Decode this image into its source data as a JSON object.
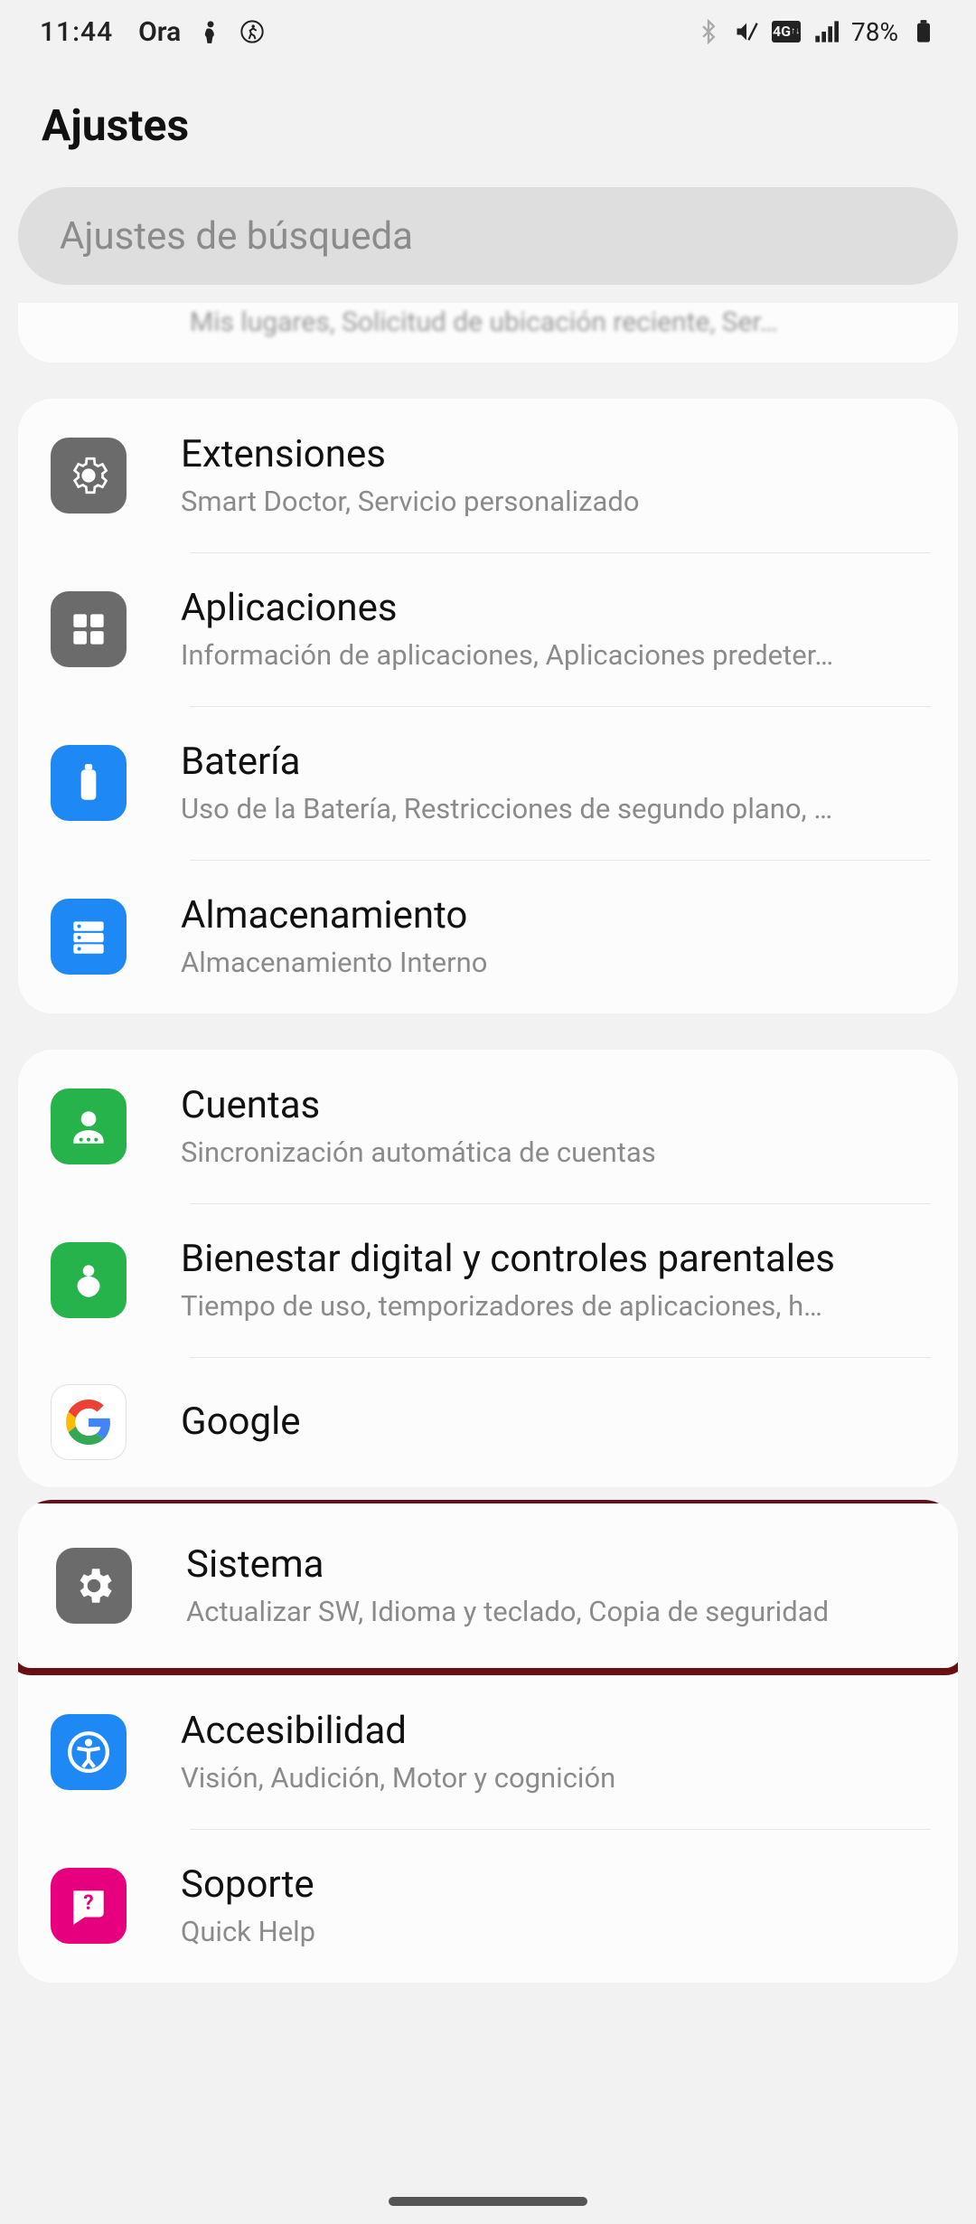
{
  "status": {
    "time": "11:44",
    "carrier_trunc": "Ora",
    "battery_pct": "78%"
  },
  "header": {
    "title": "Ajustes"
  },
  "search": {
    "placeholder": "Ajustes de búsqueda"
  },
  "truncated_prev": {
    "subtitle": "Mis lugares, Solicitud de ubicación reciente, Ser…"
  },
  "group1": [
    {
      "title": "Extensiones",
      "subtitle": "Smart Doctor, Servicio personalizado"
    },
    {
      "title": "Aplicaciones",
      "subtitle": "Información de aplicaciones, Aplicaciones predeter…"
    },
    {
      "title": "Batería",
      "subtitle": "Uso de la Batería, Restricciones de segundo plano, …"
    },
    {
      "title": "Almacenamiento",
      "subtitle": "Almacenamiento Interno"
    }
  ],
  "group2": [
    {
      "title": "Cuentas",
      "subtitle": "Sincronización automática de cuentas"
    },
    {
      "title": "Bienestar digital y controles parentales",
      "subtitle": "Tiempo de uso, temporizadores de aplicaciones, h…"
    },
    {
      "title": "Google",
      "subtitle": ""
    }
  ],
  "group3": [
    {
      "title": "Sistema",
      "subtitle": "Actualizar SW, Idioma y teclado, Copia de seguridad"
    },
    {
      "title": "Accesibilidad",
      "subtitle": "Visión, Audición, Motor y cognición"
    },
    {
      "title": "Soporte",
      "subtitle": "Quick Help"
    }
  ]
}
